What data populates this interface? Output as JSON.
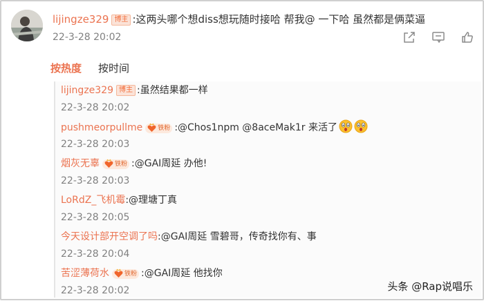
{
  "comment": {
    "author": "lijingze329",
    "badge": "博主",
    "text": ":这两头哪个想diss想玩随时接哈 帮我@ 一下哈 虽然都是俩菜逼",
    "time": "22-3-28 20:02"
  },
  "tabs": {
    "hot": "按热度",
    "time": "按时间"
  },
  "replies": [
    {
      "name": "lijingze329",
      "badge": "博主",
      "fan": "",
      "text": ":虽然结果都一样",
      "time": "22-3-28 20:02",
      "emoji": 0
    },
    {
      "name": "pushmeorpullme",
      "badge": "",
      "fan": "铁粉",
      "text": ":@Chos1npm @8aceMak1r 来活了",
      "time": "22-3-28 20:03",
      "emoji": 2
    },
    {
      "name": "烟灰无辜",
      "badge": "",
      "fan": "铁粉",
      "text": ":@GAI周延 办他!",
      "time": "22-3-28 20:03",
      "emoji": 0
    },
    {
      "name": "LoRdZ_飞机霉",
      "badge": "",
      "fan": "",
      "text": ":@理塘丁真",
      "time": "22-3-28 20:05",
      "emoji": 0
    },
    {
      "name": "今天设计部开空调了吗",
      "badge": "",
      "fan": "",
      "text": ":@GAI周延 雪碧哥，传奇找你有、事",
      "time": "22-3-28 20:04",
      "emoji": 0
    },
    {
      "name": "苦涩薄荷水",
      "badge": "",
      "fan": "铁粉",
      "text": ":@GAI周延 他找你",
      "time": "22-3-28 20:02",
      "emoji": 0
    }
  ],
  "watermark": "头条 @Rap说唱乐"
}
